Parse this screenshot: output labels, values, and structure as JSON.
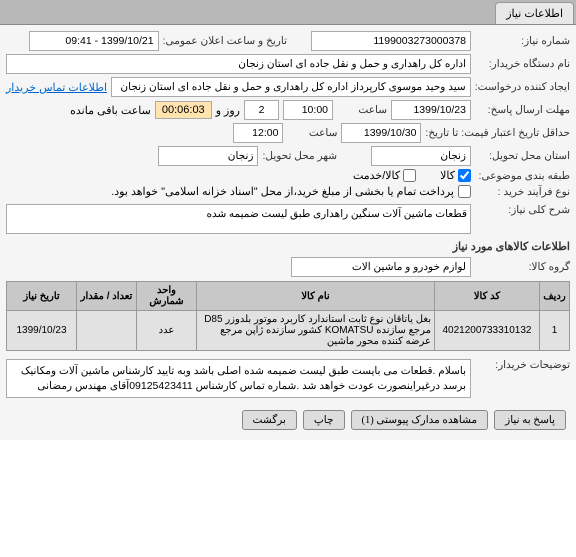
{
  "tabs": {
    "main": "اطلاعات نیاز"
  },
  "need_number_label": "شماره نیاز:",
  "need_number": "1199003273000378",
  "announce_label": "تاریخ و ساعت اعلان عمومی:",
  "announce_value": "1399/10/21 - 09:41",
  "org_label": "نام دستگاه خریدار:",
  "org_value": "اداره کل راهداری و حمل و نقل جاده ای استان زنجان",
  "creator_label": "ایجاد کننده درخواست:",
  "creator_value": "سید وحید موسوی کارپرداز اداره کل راهداری و حمل و نقل جاده ای استان زنجان",
  "buyer_link": "اطلاعات تماس خریدار",
  "deadline_label": "مهلت ارسال پاسخ:",
  "deadline_date": "1399/10/23",
  "deadline_time_label": "ساعت",
  "deadline_time": "10:00",
  "days_label": "روز و",
  "days_value": "2",
  "countdown": "00:06:03",
  "remaining_label": "ساعت باقی مانده",
  "validity_label": "حداقل تاریخ اعتبار قیمت: تا تاریخ:",
  "validity_date": "1399/10/30",
  "validity_time_label": "ساعت",
  "validity_time": "12:00",
  "delivery_state_label": "استان محل تحویل:",
  "delivery_state": "زنجان",
  "delivery_city_label": "شهر محل تحویل:",
  "delivery_city": "زنجان",
  "budget_label": "طبقه بندی موضوعی:",
  "goods_check": "کالا",
  "service_check": "کالا/خدمت",
  "purchase_type_label": "نوع فرآیند خرید :",
  "purchase_type_text": "پرداخت تمام یا بخشی از مبلغ خرید،از محل \"اسناد خزانه اسلامی\" خواهد بود.",
  "desc_label": "شرح کلی نیاز:",
  "desc_value": "قطعات ماشین آلات سنگین راهداری طبق لیست ضمیمه شده",
  "items_section": "اطلاعات کالاهای مورد نیاز",
  "group_label": "گروه کالا:",
  "group_value": "لوازم خودرو و ماشین آلات",
  "table": {
    "headers": {
      "row": "ردیف",
      "code": "کد کالا",
      "name": "نام کالا",
      "unit": "واحد شمارش",
      "qty": "تعداد / مقدار",
      "date": "تاریخ نیاز"
    },
    "rows": [
      {
        "idx": "1",
        "code": "4021200733310132",
        "name": "بغل یاتاقان نوع ثابت استاندارد کاربرد موتور بلدوزر D85 مرجع سازنده KOMATSU کشور سازنده ژاپن مرجع عرضه کننده محور ماشین",
        "unit": "عدد",
        "qty": "",
        "date": "1399/10/23"
      }
    ]
  },
  "buyer_notes_label": "توضیحات خریدار:",
  "buyer_notes": "باسلام .قطعات می بایست طبق لیست ضمیمه شده اصلی باشد وبه تایید کارشناس ماشین آلات ومکانیک برسد درغیراینصورت عودت خواهد شد .شماره تماس کارشناس 09125423411آقای مهندس رمضانی",
  "footer": {
    "reply": "پاسخ به نیاز",
    "attachments": "مشاهده مدارک پیوستی (1)",
    "print": "چاپ",
    "back": "برگشت"
  }
}
